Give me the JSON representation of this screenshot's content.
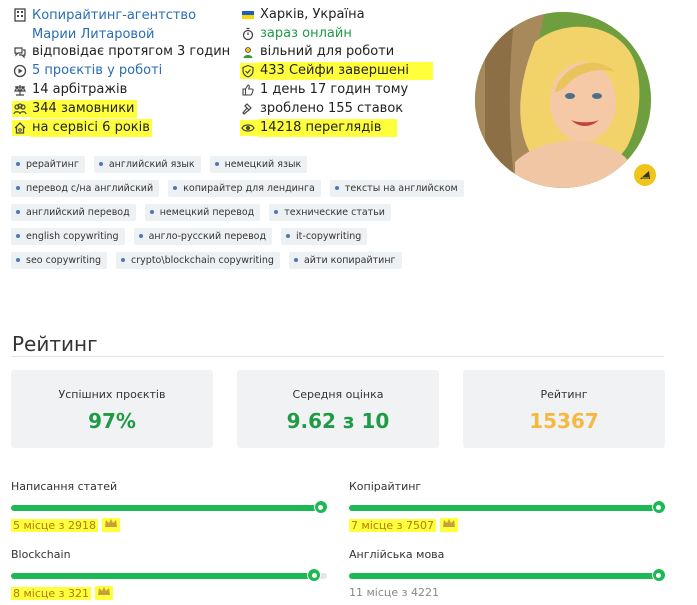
{
  "profile": {
    "company": "Копирайтинг-агентство Марии Литаровой",
    "location": "Харків, Україна",
    "online": "зараз онлайн",
    "response": "відповідає протягом 3 годин",
    "availability": "вільний для роботи",
    "projects_in_work": "5 проєктів у роботі",
    "safes_done": "433 Сейфи завершені",
    "arbitrations": "14 арбітражів",
    "last_seen": "1 день 17 годин тому",
    "customers": "344 замовники",
    "bids": "зроблено 155 ставок",
    "on_service": "на сервісі 6 років",
    "views": "14218 переглядів"
  },
  "tags": [
    [
      "рерайтинг",
      "английский язык",
      "немецкий язык"
    ],
    [
      "перевод с/на английский",
      "копирайтер для лендинга",
      "тексты на английском"
    ],
    [
      "английский перевод",
      "немецкий перевод",
      "технические статьи"
    ],
    [
      "english copywriting",
      "англо-русский перевод",
      "it-copywriting"
    ],
    [
      "seo copywriting",
      "crypto\\blockchain copywriting",
      "айти копирайтинг"
    ]
  ],
  "rating": {
    "title": "Рейтинг",
    "cards": [
      {
        "label": "Успішних проєктів",
        "value": "97%",
        "color": "#1f9a45"
      },
      {
        "label": "Середня оцінка",
        "value": "9.62 з 10",
        "color": "#1f9a45"
      },
      {
        "label": "Рейтинг",
        "value": "15367",
        "color": "#f5b942"
      }
    ]
  },
  "skills": [
    {
      "name": "Написання статей",
      "place": "5 місце з 2918",
      "progress": 0.98,
      "crown": true
    },
    {
      "name": "Копірайтинг",
      "place": "7 місце з 7507",
      "progress": 0.98,
      "crown": true
    },
    {
      "name": "Blockchain",
      "place": "8 місце з 321",
      "progress": 0.96,
      "crown": true
    },
    {
      "name": "Англійська мова",
      "place": "11 місце з 4221",
      "progress": 0.98,
      "crown": false
    }
  ],
  "colors": {
    "accent_green": "#1db954",
    "link": "#2a6db5",
    "highlight": "#ffff3b",
    "gold": "#b07a13"
  }
}
